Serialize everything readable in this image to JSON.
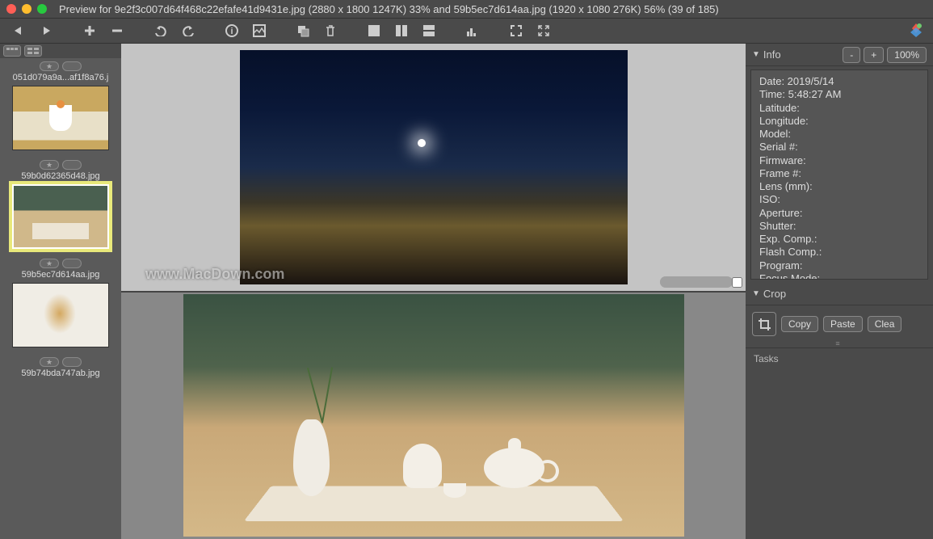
{
  "title": "Preview for 9e2f3c007d64f468c22efafe41d9431e.jpg (2880 x 1800 1247K) 33% and 59b5ec7d614aa.jpg (1920 x 1080 276K) 56% (39 of 185)",
  "watermark": "www.MacDown.com",
  "thumbs": [
    {
      "name": "051d079a9a...af1f8a76.j"
    },
    {
      "name": "59b0d62365d48.jpg"
    },
    {
      "name": "59b5ec7d614aa.jpg"
    },
    {
      "name": "59b74bda747ab.jpg"
    }
  ],
  "info": {
    "header": "Info",
    "minus": "-",
    "plus": "+",
    "pct": "100%",
    "rows": [
      "Date: 2019/5/14",
      "Time: 5:48:27 AM",
      "Latitude:",
      "Longitude:",
      "Model:",
      "Serial #:",
      "Firmware:",
      "Frame #:",
      "Lens (mm):",
      "ISO:",
      "Aperture:",
      "Shutter:",
      "Exp. Comp.:",
      "Flash Comp.:",
      "Program:",
      "Focus Mode:"
    ]
  },
  "crop": {
    "header": "Crop",
    "copy": "Copy",
    "paste": "Paste",
    "clear": "Clea"
  },
  "tasks": {
    "header": "Tasks"
  }
}
